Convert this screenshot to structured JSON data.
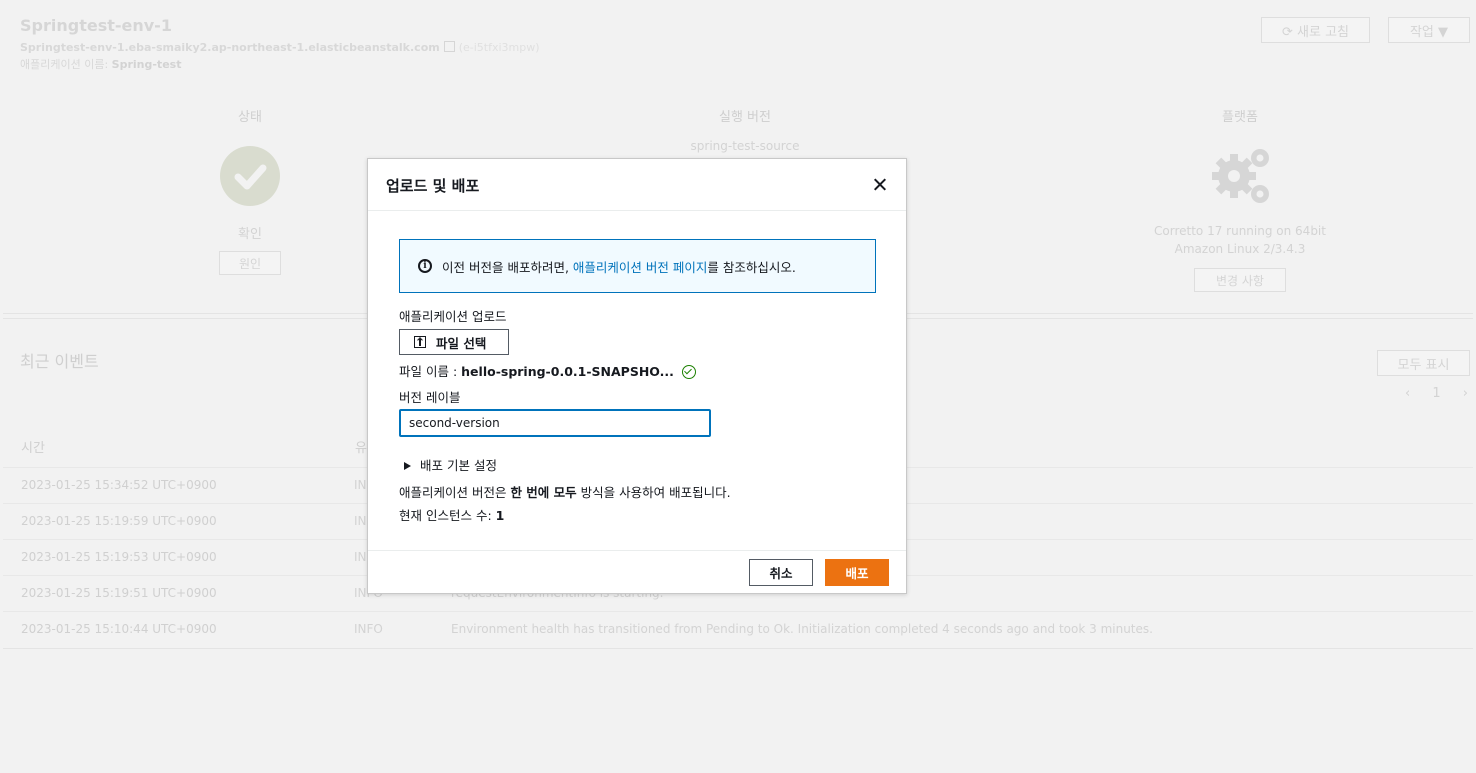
{
  "env": {
    "title": "Springtest-env-1",
    "url": "Springtest-env-1.eba-smaiky2.ap-northeast-1.elasticbeanstalk.com",
    "env_id": "(e-i5tfxi3mpw)",
    "app_label": "애플리케이션 이름:",
    "app_name": "Spring-test",
    "refresh_label": "⟳ 새로 고침",
    "actions_label": "작업 ▼"
  },
  "summary": {
    "health_title": "상태",
    "health_status": "확인",
    "health_button": "원인",
    "version_title": "실행 버전",
    "version_value": "spring-test-source",
    "platform_title": "플랫폼",
    "platform_line1": "Corretto 17 running on 64bit",
    "platform_line2": "Amazon Linux 2/3.4.3",
    "platform_button": "변경 사항"
  },
  "events": {
    "title": "최근 이벤트",
    "show_all": "모두 표시",
    "page": "1",
    "col_time": "시간",
    "col_type": "유",
    "rows": [
      {
        "time": "2023-01-25 15:34:52 UTC+0900",
        "type": "INF",
        "message": ""
      },
      {
        "time": "2023-01-25 15:19:59 UTC+0900",
        "type": "INF",
        "message": ""
      },
      {
        "time": "2023-01-25 15:19:53 UTC+0900",
        "type": "INF",
        "message": ""
      },
      {
        "time": "2023-01-25 15:19:51 UTC+0900",
        "type": "INFO",
        "message": "requestEnvironmentInfo is starting."
      },
      {
        "time": "2023-01-25 15:10:44 UTC+0900",
        "type": "INFO",
        "message": "Environment health has transitioned from Pending to Ok. Initialization completed 4 seconds ago and took 3 minutes."
      }
    ]
  },
  "modal": {
    "title": "업로드 및 배포",
    "info_prefix": "이전 버전을 배포하려면, ",
    "info_link": "애플리케이션 버전 페이지",
    "info_suffix": "를 참조하십시오.",
    "upload_label": "애플리케이션 업로드",
    "file_button": "파일 선택",
    "file_name_label": "파일 이름 :",
    "file_name": "hello-spring-0.0.1-SNAPSHO...",
    "version_label": "버전 레이블",
    "version_value": "second-version",
    "deploy_settings": "배포 기본 설정",
    "deploy_note_prefix": "애플리케이션 버전은 ",
    "deploy_note_bold": "한 번에 모두",
    "deploy_note_suffix": " 방식을 사용하여 배포됩니다.",
    "instances_label": "현재 인스턴스 수: ",
    "instances_value": "1",
    "cancel_label": "취소",
    "deploy_label": "배포"
  },
  "colors": {
    "accent": "#ec7211",
    "link": "#0073bb",
    "success": "#1d8102"
  }
}
